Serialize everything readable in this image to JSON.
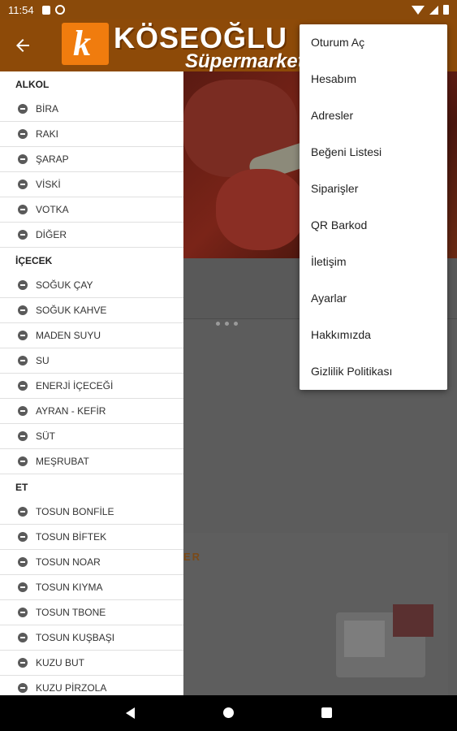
{
  "status_bar": {
    "time": "11:54"
  },
  "app_bar": {
    "logo_letter": "k",
    "brand_name": "KÖSEOĞLU",
    "brand_sub": "Süpermarket"
  },
  "drawer": {
    "categories": [
      {
        "title": "ALKOL",
        "items": [
          "BİRA",
          "RAKI",
          "ŞARAP",
          "VİSKİ",
          "VOTKA",
          "DİĞER"
        ]
      },
      {
        "title": "İÇECEK",
        "items": [
          "SOĞUK ÇAY",
          "SOĞUK KAHVE",
          "MADEN SUYU",
          "SU",
          "ENERJİ İÇECEĞİ",
          "AYRAN - KEFİR",
          "SÜT",
          "MEŞRUBAT"
        ]
      },
      {
        "title": "ET",
        "items": [
          "TOSUN BONFİLE",
          "TOSUN BİFTEK",
          "TOSUN NOAR",
          "TOSUN KIYMA",
          "TOSUN TBONE",
          "TOSUN KUŞBAŞI",
          "KUZU BUT",
          "KUZU PİRZOLA"
        ]
      }
    ]
  },
  "content": {
    "card_title": "ER"
  },
  "menu": {
    "items": [
      "Oturum Aç",
      "Hesabım",
      "Adresler",
      "Beğeni Listesi",
      "Siparişler",
      "QR Barkod",
      "İletişim",
      "Ayarlar",
      "Hakkımızda",
      "Gizlilik Politikası"
    ]
  },
  "colors": {
    "app_bar": "#8d4a08",
    "logo_bg": "#f07c0e",
    "accent": "#f07c0e"
  }
}
